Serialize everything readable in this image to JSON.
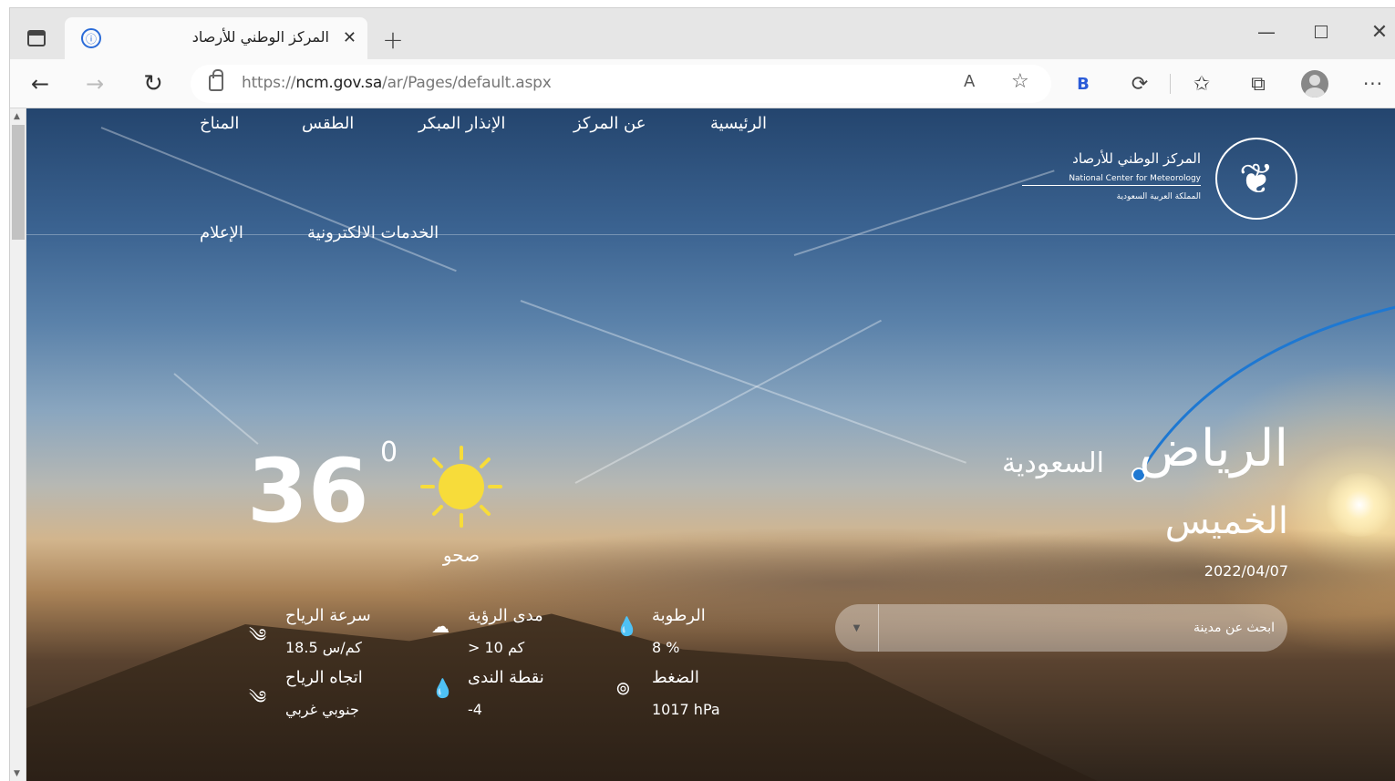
{
  "browser": {
    "tab_title": "المركز الوطني للأرصاد",
    "url_prefix": "https://",
    "url_host": "ncm.gov.sa",
    "url_path": "/ar/Pages/default.aspx",
    "read_aloud": "A",
    "ext_label": "B"
  },
  "site": {
    "org_name_ar": "المركز الوطني للأرصاد",
    "org_name_en": "National Center for Meteorology",
    "org_sub_ar": "المملكة العربية السعودية",
    "nav": [
      {
        "label": "الرئيسية"
      },
      {
        "label": "عن المركز"
      },
      {
        "label": "الإنذار المبكر"
      },
      {
        "label": "الطقس"
      },
      {
        "label": "المناخ"
      },
      {
        "label": "الخدمات الالكترونية"
      },
      {
        "label": "الإعلام"
      }
    ]
  },
  "weather": {
    "city": "الرياض",
    "country": "السعودية",
    "day": "الخميس",
    "date": "2022/04/07",
    "search_placeholder": "ابحث عن مدينة",
    "temperature": "36",
    "temp_unit": "0",
    "condition": "صحو",
    "stats": {
      "humidity_label": "الرطوبة",
      "humidity_value": "8 %",
      "visibility_label": "مدى الرؤية",
      "visibility_value": "> 10 كم",
      "wind_speed_label": "سرعة الرياح",
      "wind_speed_value": "18.5 كم/س",
      "pressure_label": "الضغط",
      "pressure_value": "1017 hPa",
      "dew_point_label": "نقطة الندى",
      "dew_point_value": "-4",
      "wind_dir_label": "اتجاه الرياح",
      "wind_dir_value": "جنوبي غربي"
    }
  },
  "colors": {
    "accent_blue": "#1e78d2",
    "sun_yellow": "#f7dc3a"
  }
}
